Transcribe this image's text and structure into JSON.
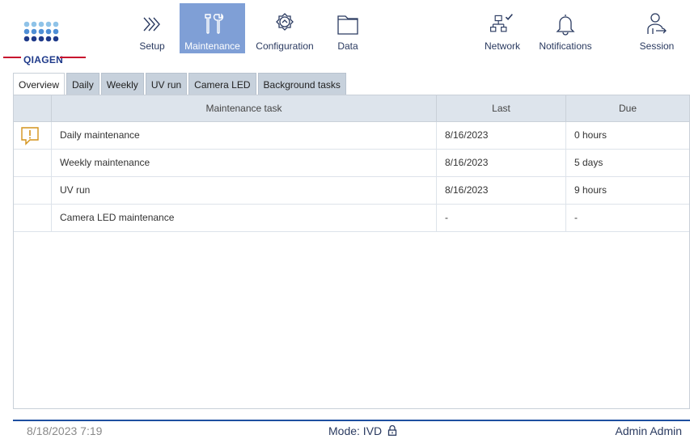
{
  "brand": {
    "name": "QIAGEN"
  },
  "nav": {
    "setup": "Setup",
    "maintenance": "Maintenance",
    "configuration": "Configuration",
    "data": "Data",
    "network": "Network",
    "notifications": "Notifications",
    "session": "Session",
    "active": "Maintenance"
  },
  "tabs": [
    {
      "label": "Overview",
      "active": true
    },
    {
      "label": "Daily"
    },
    {
      "label": "Weekly"
    },
    {
      "label": "UV run"
    },
    {
      "label": "Camera LED"
    },
    {
      "label": "Background tasks"
    }
  ],
  "table": {
    "headers": {
      "task": "Maintenance task",
      "last": "Last",
      "due": "Due"
    },
    "rows": [
      {
        "warning": true,
        "task": "Daily maintenance",
        "last": "8/16/2023",
        "due": "0 hours"
      },
      {
        "warning": false,
        "task": "Weekly maintenance",
        "last": "8/16/2023",
        "due": "5 days"
      },
      {
        "warning": false,
        "task": "UV run",
        "last": "8/16/2023",
        "due": "9 hours"
      },
      {
        "warning": false,
        "task": "Camera LED maintenance",
        "last": "-",
        "due": "-"
      }
    ]
  },
  "footer": {
    "datetime": "8/18/2023 7:19",
    "mode": "Mode: IVD",
    "user": "Admin Admin"
  },
  "colors": {
    "accent": "#7f9fd6",
    "brand_blue": "#1e4fa0",
    "warning": "#d4931b",
    "brand_red": "#c8102e"
  },
  "icons": [
    "setup-icon",
    "maintenance-icon",
    "configuration-icon",
    "data-icon",
    "network-icon",
    "notifications-icon",
    "session-icon",
    "warning-icon",
    "lock-icon"
  ]
}
